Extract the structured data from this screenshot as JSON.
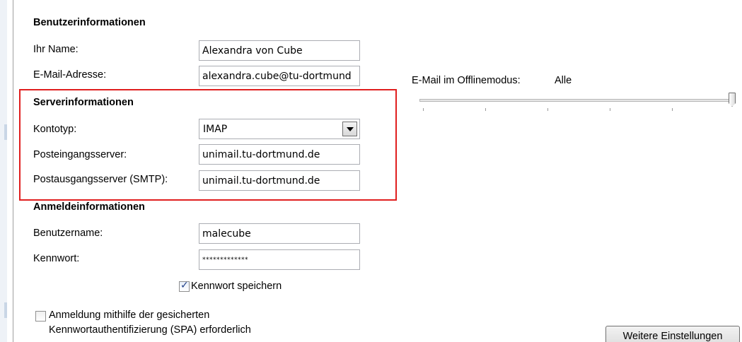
{
  "user_info": {
    "title": "Benutzerinformationen",
    "name_label": "Ihr Name:",
    "name_value": "Alexandra von Cube",
    "email_label": "E-Mail-Adresse:",
    "email_value": "alexandra.cube@tu-dortmund"
  },
  "server_info": {
    "title": "Serverinformationen",
    "account_type_label": "Kontotyp:",
    "account_type_value": "IMAP",
    "incoming_label": "Posteingangsserver:",
    "incoming_value": "unimail.tu-dortmund.de",
    "outgoing_label": "Postausgangsserver (SMTP):",
    "outgoing_value": "unimail.tu-dortmund.de"
  },
  "login_info": {
    "title": "Anmeldeinformationen",
    "username_label": "Benutzername:",
    "username_value": "malecube",
    "password_label": "Kennwort:",
    "password_value": "*************",
    "remember_label": "Kennwort speichern",
    "remember_checked": true,
    "spa_label_line1": "Anmeldung mithilfe der gesicherten",
    "spa_label_line2": "Kennwortauthentifizierung (SPA) erforderlich",
    "spa_checked": false
  },
  "offline": {
    "label": "E-Mail im Offlinemodus:",
    "value": "Alle",
    "slider_level": 1.0
  },
  "buttons": {
    "more_settings": "Weitere Einstellungen"
  },
  "colors": {
    "highlight_border": "#e01e1e",
    "checkmark": "#1f3f88"
  }
}
